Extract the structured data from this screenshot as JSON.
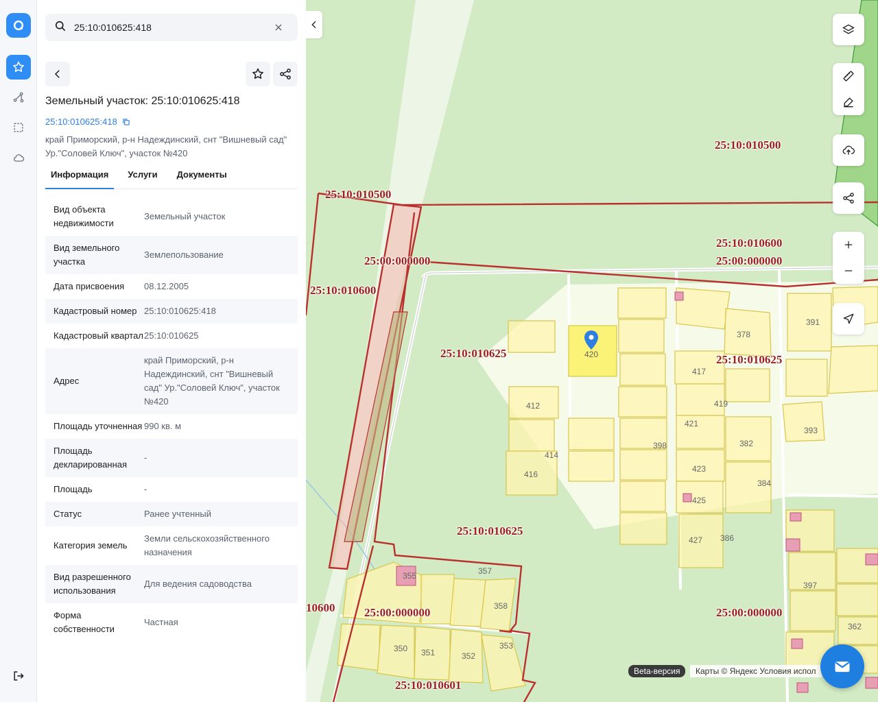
{
  "search": {
    "value": "25:10:010625:418"
  },
  "object": {
    "title": "Земельный участок: 25:10:010625:418",
    "cad_number": "25:10:010625:418",
    "address": "край Приморский, р-н Надеждинский, снт \"Вишневый сад\" Ур.\"Соловей Ключ\", участок №420"
  },
  "tabs": [
    {
      "label": "Информация"
    },
    {
      "label": "Услуги"
    },
    {
      "label": "Документы"
    }
  ],
  "info_rows": [
    {
      "key": "Вид объекта недвижимости",
      "value": "Земельный участок"
    },
    {
      "key": "Вид земельного участка",
      "value": "Землепользование"
    },
    {
      "key": "Дата присвоения",
      "value": "08.12.2005"
    },
    {
      "key": "Кадастровый номер",
      "value": "25:10:010625:418"
    },
    {
      "key": "Кадастровый квартал",
      "value": "25:10:010625"
    },
    {
      "key": "Адрес",
      "value": "край Приморский, р-н Надеждинский, снт \"Вишневый сад\" Ур.\"Соловей Ключ\", участок №420"
    },
    {
      "key": "Площадь уточненная",
      "value": "990 кв. м"
    },
    {
      "key": "Площадь декларированная",
      "value": "-"
    },
    {
      "key": "Площадь",
      "value": "-"
    },
    {
      "key": "Статус",
      "value": "Ранее учтенный"
    },
    {
      "key": "Категория земель",
      "value": "Земли сельскохозяйственного назначения"
    },
    {
      "key": "Вид разрешенного использования",
      "value": "Для ведения садоводства"
    },
    {
      "key": "Форма собственности",
      "value": "Частная"
    }
  ],
  "map": {
    "labels": [
      {
        "text": "25:10:010500"
      },
      {
        "text": "25:10:010500"
      },
      {
        "text": "25:00:000000"
      },
      {
        "text": "25:10:010600"
      },
      {
        "text": "25:10:010625"
      },
      {
        "text": "25:10:010600"
      },
      {
        "text": "25:00:000000"
      },
      {
        "text": "25:10:010625"
      },
      {
        "text": "25:10:010625"
      },
      {
        "text": "10600"
      },
      {
        "text": "25:00:000000"
      },
      {
        "text": "25:00:000000"
      },
      {
        "text": "25:10:010601"
      }
    ],
    "parcel_numbers": [
      "420",
      "378",
      "391",
      "417",
      "419",
      "412",
      "393",
      "421",
      "382",
      "414",
      "416",
      "398",
      "423",
      "384",
      "425",
      "427",
      "386",
      "357",
      "355",
      "358",
      "397",
      "350",
      "351",
      "352",
      "353",
      "362"
    ],
    "beta": "Beta-версия",
    "attribution": "Карты © Яндекс   Условия испол"
  },
  "icons": {
    "logo": "app-logo-icon",
    "favorites": "star-icon",
    "routes": "route-icon",
    "select": "select-area-icon",
    "cloud": "cloud-icon",
    "logout": "logout-icon"
  },
  "colors": {
    "accent": "#2e8ef5",
    "link": "#2e7fe0",
    "boundary": "#b8312f",
    "parcel": "#fff5b0"
  }
}
